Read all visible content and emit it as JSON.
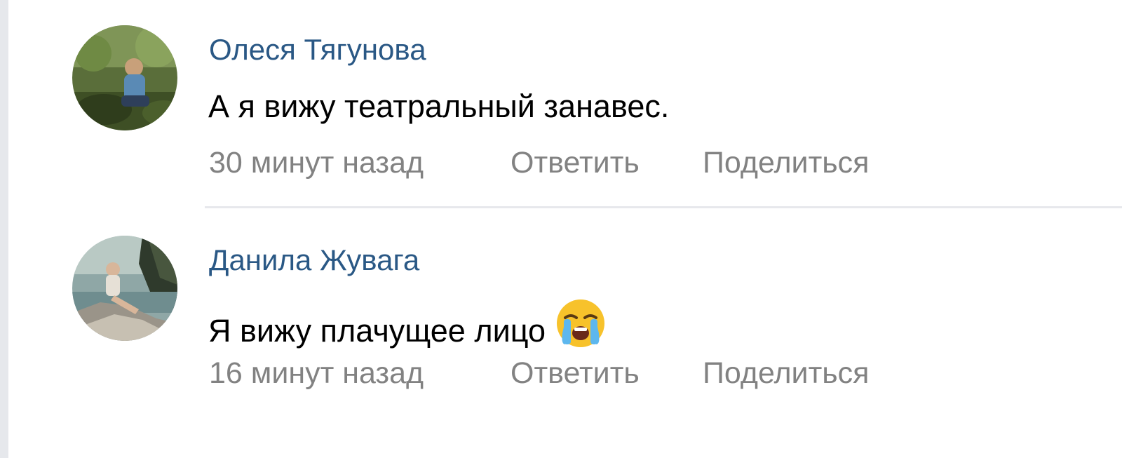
{
  "comments": [
    {
      "author": "Олеся Тягунова",
      "text": "А я вижу театральный занавес.",
      "time": "30 минут назад",
      "reply_label": "Ответить",
      "share_label": "Поделиться",
      "avatar_icon": "user-avatar"
    },
    {
      "author": "Данила Жувага",
      "text": "Я вижу плачущее лицо",
      "emoji": "loudly-crying-face-icon",
      "time": "16 минут назад",
      "reply_label": "Ответить",
      "share_label": "Поделиться",
      "avatar_icon": "user-avatar"
    }
  ],
  "colors": {
    "author": "#2a5885",
    "meta": "#828282",
    "text": "#000000",
    "divider": "#e7e8ec",
    "page_bg": "#e6e8ec"
  }
}
